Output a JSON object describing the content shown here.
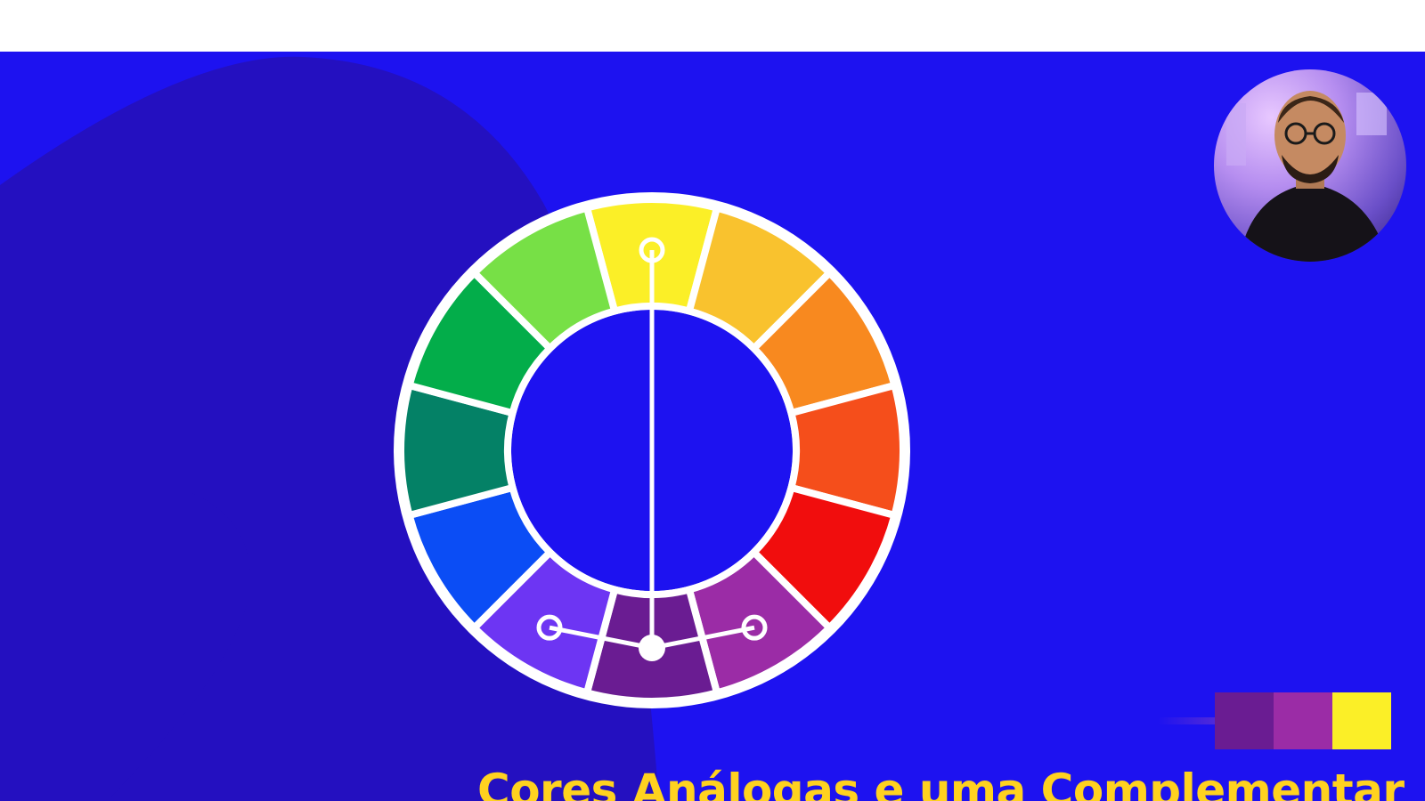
{
  "caption": {
    "text": "Cores Análogas e uma Complementar",
    "color": "#ffd21f"
  },
  "colors": {
    "background": "#1d12f0",
    "background_shape": "#2410c0",
    "wheel_segments_clockwise_from_top": [
      "#fbef27",
      "#f9c22e",
      "#f8891f",
      "#f54e1b",
      "#f10d0d",
      "#9b2ca6",
      "#6a1c92",
      "#6d35f3",
      "#0b4df5",
      "#048166",
      "#03ad4a",
      "#77e046"
    ],
    "swatch_palette": [
      "#6a1c92",
      "#9b2ca6",
      "#fbef27"
    ]
  },
  "wheel": {
    "segment_count": 12,
    "selected_segment_indices": [
      0,
      5,
      6,
      7
    ],
    "primary_selected_color": "#6a1c92",
    "complement_color": "#fbef27"
  },
  "icons": {
    "presenter": "presenter-webcam-icon",
    "connector": "scheme-connector-icon"
  }
}
